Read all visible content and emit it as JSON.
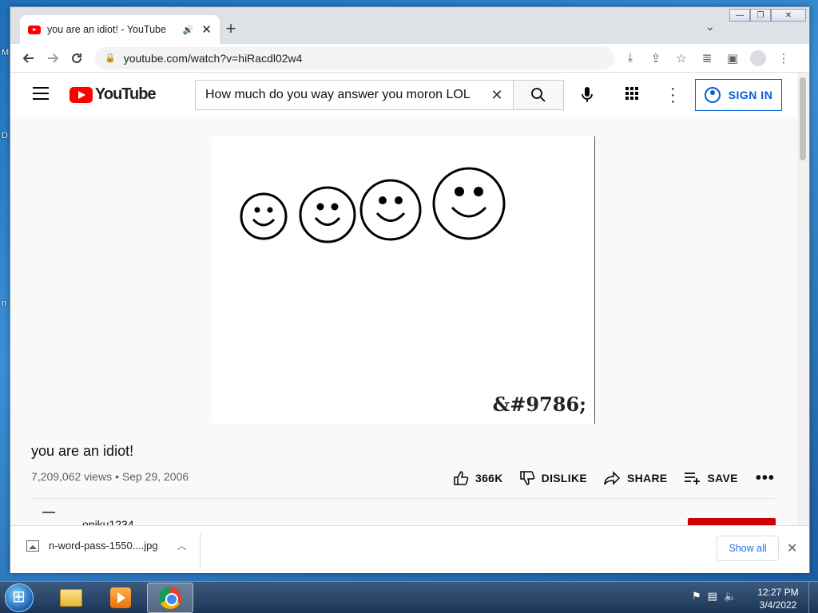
{
  "desktop": {
    "fragments": [
      "M",
      "D",
      "n"
    ]
  },
  "browser": {
    "tab": {
      "title": "you are an idiot! - YouTube",
      "speaker": "🔊",
      "close": "✕"
    },
    "newtab": "+",
    "tab_search": "⌄",
    "url": "youtube.com/watch?v=hiRacdl02w4",
    "icons": [
      "back-icon",
      "forward-icon",
      "reload-icon",
      "lock-icon",
      "install-icon",
      "share-icon",
      "star-icon",
      "reading-list-icon",
      "side-panel-icon",
      "profile-icon",
      "menu-icon"
    ]
  },
  "youtube": {
    "logo_text": "YouTube",
    "search": {
      "query": "How much do you way answer you moron LOL"
    },
    "sign_in": "SIGN IN",
    "video": {
      "overlay_text": "&#9786;"
    },
    "title": "you are an idiot!",
    "meta": "7,209,062 views • Sep 29, 2006",
    "actions": {
      "like": "366K",
      "dislike": "DISLIKE",
      "share": "SHARE",
      "save": "SAVE",
      "more": "•••"
    },
    "channel": "oniku1234",
    "brand_color": "#ff0000",
    "accent_color": "#065fd4"
  },
  "downloads": {
    "file": "n-word-pass-1550....jpg",
    "show_all": "Show all"
  },
  "taskbar": {
    "time": "12:27 PM",
    "date": "3/4/2022"
  }
}
